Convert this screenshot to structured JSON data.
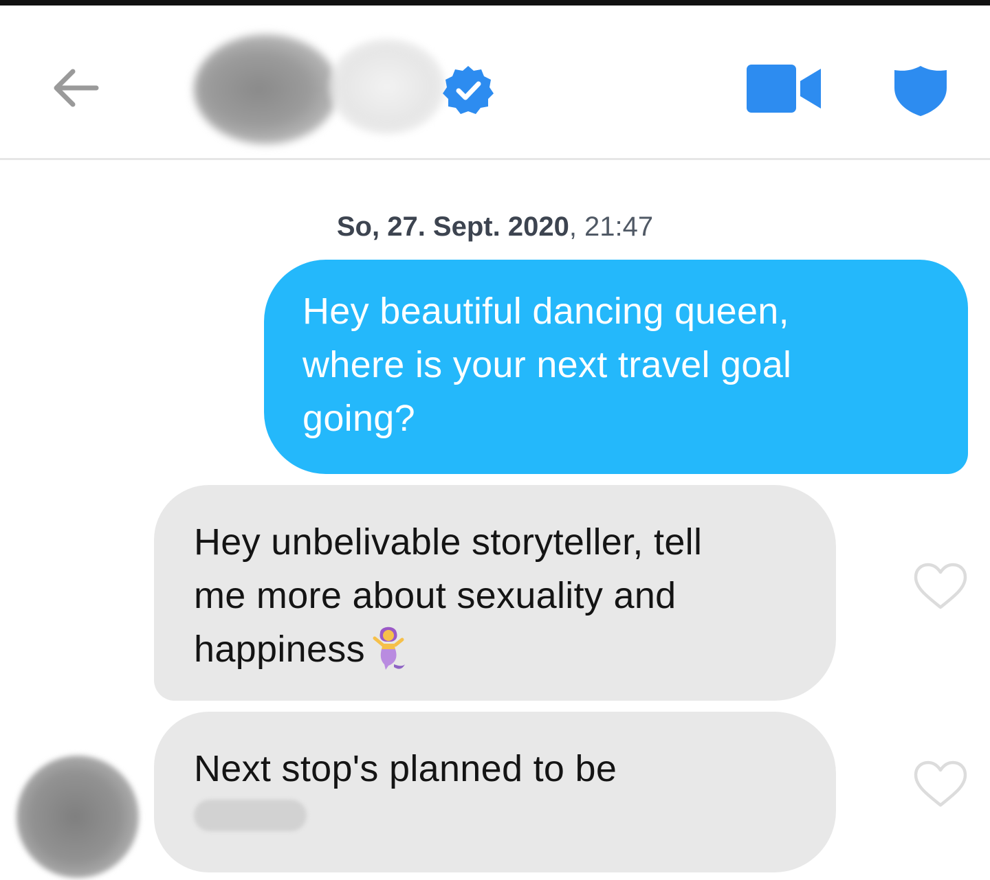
{
  "header": {
    "back_icon": "arrow-left-icon",
    "verified_icon": "verified-check-badge-icon",
    "video_icon": "video-camera-icon",
    "safety_icon": "shield-icon",
    "accent_color": "#2d8cf0"
  },
  "conversation": {
    "timestamp_date": "So, 27. Sept. 2020",
    "timestamp_time": ", 21:47",
    "messages": [
      {
        "direction": "outgoing",
        "lines": [
          "Hey beautiful dancing queen,",
          "where is your next travel goal",
          "going?"
        ],
        "color": "#24b8fb"
      },
      {
        "direction": "incoming",
        "lines": [
          "Hey unbelivable storyteller, tell",
          "me more about sexuality and",
          "happiness"
        ],
        "emoji": "mermaid-emoji",
        "like_icon": "heart-outline-icon",
        "color": "#e8e8e8"
      },
      {
        "direction": "incoming",
        "lines": [
          "Next stop's planned to be"
        ],
        "like_icon": "heart-outline-icon",
        "color": "#e8e8e8"
      }
    ]
  }
}
